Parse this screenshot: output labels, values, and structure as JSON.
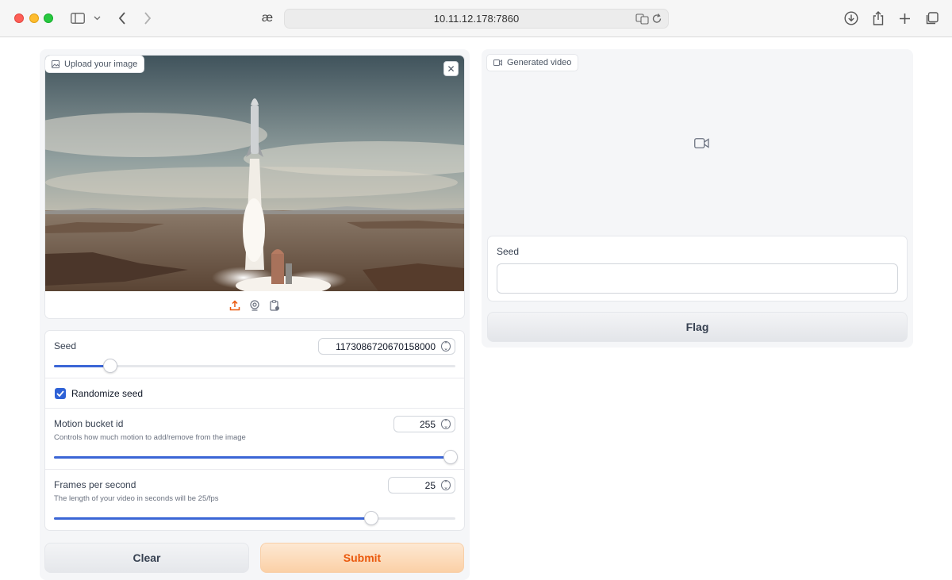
{
  "browser": {
    "url": "10.11.12.178:7860"
  },
  "left": {
    "image_panel": {
      "label": "Upload your image",
      "close": "✕"
    },
    "seed": {
      "label": "Seed",
      "value": "1173086720670158000",
      "fraction": 0.14
    },
    "randomize": {
      "label": "Randomize seed",
      "checked": true
    },
    "motion": {
      "label": "Motion bucket id",
      "info": "Controls how much motion to add/remove from the image",
      "value": "255",
      "fraction": 1.0
    },
    "fps": {
      "label": "Frames per second",
      "info": "The length of your video in seconds will be 25/fps",
      "value": "25",
      "fraction": 0.79
    },
    "buttons": {
      "clear": "Clear",
      "submit": "Submit"
    }
  },
  "right": {
    "video": {
      "label": "Generated video"
    },
    "seed": {
      "label": "Seed",
      "value": ""
    },
    "flag": "Flag"
  },
  "colors": {
    "accent": "#3b66d6",
    "submit_text": "#ea580c"
  },
  "icons": [
    "sidebar-icon",
    "back-icon",
    "forward-icon",
    "translate-icon",
    "reload-icon",
    "download-icon",
    "share-icon",
    "plus-icon",
    "tabs-icon",
    "upload-icon",
    "webcam-icon",
    "clipboard-icon",
    "video-camera-icon"
  ]
}
